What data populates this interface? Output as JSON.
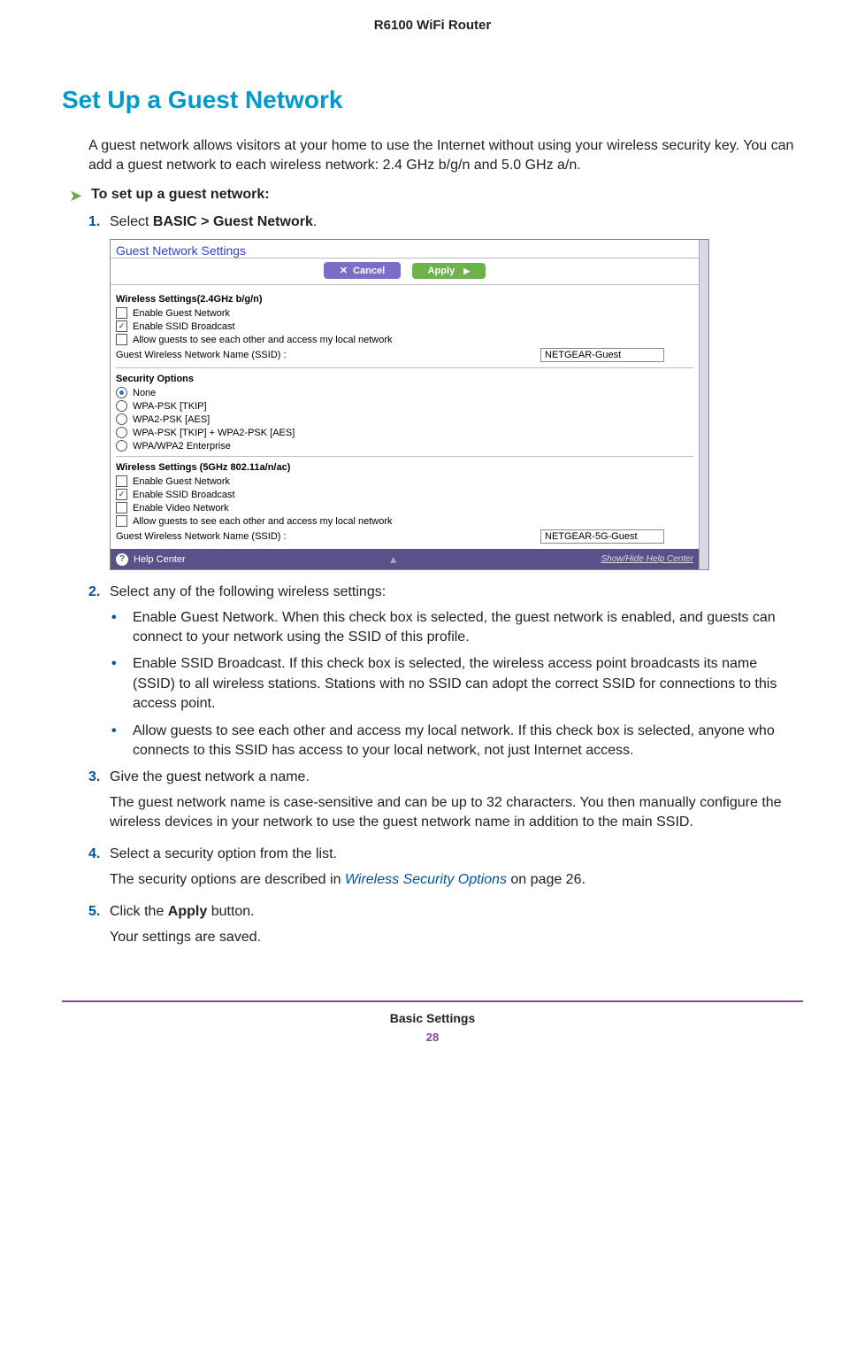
{
  "header": {
    "product": "R6100 WiFi Router"
  },
  "section": {
    "heading": "Set Up a Guest Network"
  },
  "intro": "A guest network allows visitors at your home to use the Internet without using your wireless security key. You can add a guest network to each wireless network: 2.4 GHz b/g/n and 5.0 GHz a/n.",
  "task": "To set up a guest network:",
  "steps": {
    "s1": {
      "num": "1.",
      "prefix": "Select ",
      "bold": "BASIC > Guest Network",
      "suffix": "."
    },
    "s2": {
      "num": "2.",
      "text": "Select any of the following wireless settings:"
    },
    "s3": {
      "num": "3.",
      "text": "Give the guest network a name.",
      "para": "The guest network name is case-sensitive and can be up to 32 characters. You then manually configure the wireless devices in your network to use the guest network name in addition to the main SSID."
    },
    "s4": {
      "num": "4.",
      "text": "Select a security option from the list.",
      "para_prefix": "The security options are described in ",
      "para_link": "Wireless Security Options",
      "para_suffix": " on page 26."
    },
    "s5": {
      "num": "5.",
      "prefix": "Click the ",
      "bold": "Apply",
      "suffix": " button.",
      "para": "Your settings are saved."
    }
  },
  "bullets": {
    "b1": {
      "bold": "Enable Guest Network",
      "text": ". When this check box is selected, the guest network is enabled, and guests can connect to your network using the SSID of this profile."
    },
    "b2": {
      "bold": "Enable SSID Broadcast",
      "text": ". If this check box is selected, the wireless access point broadcasts its name (SSID) to all wireless stations. Stations with no SSID can adopt the correct SSID for connections to this access point."
    },
    "b3": {
      "bold": "Allow guests to see each other and access my local network",
      "text": ". If this check box is selected, anyone who connects to this SSID has access to your local network, not just Internet access."
    }
  },
  "screenshot": {
    "title": "Guest Network Settings",
    "cancel": "Cancel",
    "apply": "Apply",
    "section24": "Wireless Settings(2.4GHz b/g/n)",
    "cb_enable_guest": "Enable Guest Network",
    "cb_enable_ssid": "Enable SSID Broadcast",
    "cb_allow_guests": "Allow guests to see each other and access my local network",
    "ssid_label": "Guest Wireless Network Name (SSID) :",
    "ssid_value_24": "NETGEAR-Guest",
    "sec_title": "Security Options",
    "r_none": "None",
    "r_wpa_tkip": "WPA-PSK [TKIP]",
    "r_wpa2_aes": "WPA2-PSK [AES]",
    "r_wpa_mix": "WPA-PSK [TKIP] + WPA2-PSK [AES]",
    "r_wpa_ent": "WPA/WPA2 Enterprise",
    "section5": "Wireless Settings (5GHz 802.11a/n/ac)",
    "cb_enable_video": "Enable Video Network",
    "ssid_value_5": "NETGEAR-5G-Guest",
    "help_center": "Help Center",
    "help_toggle": "Show/Hide Help Center"
  },
  "footer": {
    "section": "Basic Settings",
    "page": "28"
  }
}
